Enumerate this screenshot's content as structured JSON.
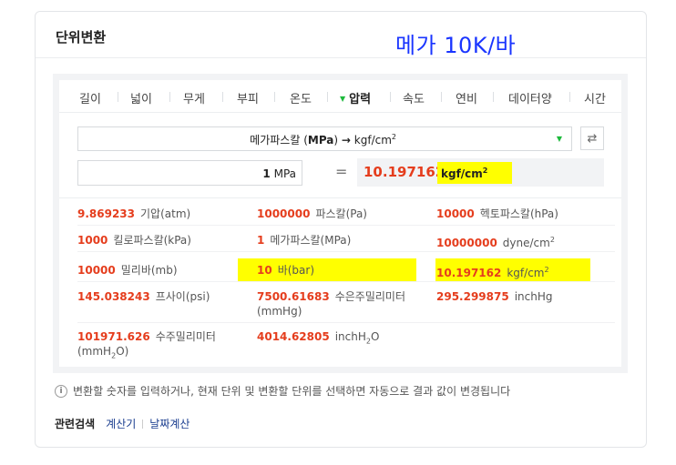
{
  "header": {
    "title": "단위변환"
  },
  "annotation": {
    "text": "메가 10K/바"
  },
  "tabs": [
    {
      "label": "길이"
    },
    {
      "label": "넓이"
    },
    {
      "label": "무게"
    },
    {
      "label": "부피"
    },
    {
      "label": "온도"
    },
    {
      "label": "압력"
    },
    {
      "label": "속도"
    },
    {
      "label": "연비"
    },
    {
      "label": "데이터양"
    },
    {
      "label": "시간"
    }
  ],
  "active_tab": "압력",
  "selector": {
    "from_unit": "메가파스칼",
    "from_abbr": "MPa",
    "arrow": "→",
    "to_unit": "kgf/cm",
    "to_sup": "2"
  },
  "input": {
    "value": "1",
    "unit": "MPa"
  },
  "equals": "=",
  "result": {
    "value": "10.197162",
    "unit": "kgf/cm",
    "unit_sup": "2"
  },
  "conversions": [
    {
      "num": "9.869233",
      "unit": "기압(atm)"
    },
    {
      "num": "1000000",
      "unit": "파스칼(Pa)"
    },
    {
      "num": "10000",
      "unit": "헥토파스칼(hPa)"
    },
    {
      "num": "1000",
      "unit": "킬로파스칼(kPa)"
    },
    {
      "num": "1",
      "unit": "메가파스칼(MPa)"
    },
    {
      "num": "10000000",
      "unit": "dyne/cm",
      "sup": "2"
    },
    {
      "num": "10000",
      "unit": "밀리바(mb)"
    },
    {
      "num": "10",
      "unit": "바(bar)"
    },
    {
      "num": "10.197162",
      "unit": "kgf/cm",
      "sup": "2"
    },
    {
      "num": "145.038243",
      "unit": "프사이(psi)"
    },
    {
      "num": "7500.61683",
      "unit": "수은주밀리미터",
      "unit2": "(mmHg)"
    },
    {
      "num": "295.299875",
      "unit": "inchHg"
    },
    {
      "num": "101971.626",
      "unit": "수주밀리미터",
      "unit2a": "(mmH",
      "unit2sub": "2",
      "unit2b": "O)"
    },
    {
      "num": "4014.62805",
      "unit": "inchH",
      "sub": "2",
      "unit_after": "O"
    }
  ],
  "info": {
    "icon": "i",
    "text": "변환할 숫자를 입력하거나, 현재 단위 및 변환할 단위를 선택하면 자동으로 결과 값이 변경됩니다"
  },
  "related": {
    "label": "관련검색",
    "links": [
      "계산기",
      "날짜계산"
    ]
  },
  "colors": {
    "accent_red": "#e53d1d",
    "highlight": "#ffff00",
    "annotation_blue": "#1a35ff",
    "active_green": "#1dba3c",
    "link": "#1a3d8f"
  },
  "icons": {
    "swap": "swap-arrows-icon",
    "info": "info-icon",
    "dropdown": "caret-down-icon"
  }
}
